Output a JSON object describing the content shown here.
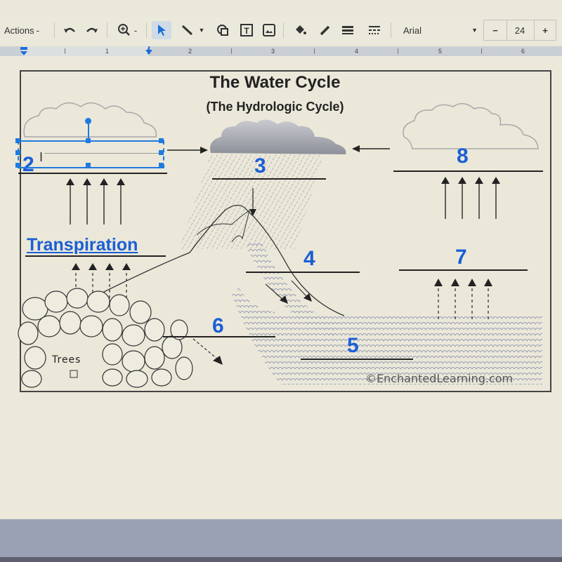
{
  "toolbar": {
    "actions_label": "Actions",
    "font_name": "Arial",
    "font_size": "24",
    "minus_label": "−",
    "plus_label": "+",
    "icons": [
      "undo-icon",
      "redo-icon",
      "zoom-icon",
      "select-pointer-icon",
      "line-icon",
      "shape-icon",
      "textbox-icon",
      "image-icon",
      "fill-color-icon",
      "line-color-icon",
      "line-weight-icon",
      "line-dash-icon"
    ]
  },
  "ruler": {
    "numbers": [
      "1",
      "2",
      "3",
      "4",
      "5",
      "6"
    ]
  },
  "diagram": {
    "title": "The Water Cycle",
    "subtitle": "(The Hydrologic Cycle)",
    "labels": {
      "n2": "2",
      "n3": "3",
      "n4": "4",
      "n5": "5",
      "n6": "6",
      "n7": "7",
      "n8": "8"
    },
    "transpiration": "Transpiration",
    "trees": "Trees",
    "copyright": "©EnchantedLearning.com"
  },
  "colors": {
    "label_blue": "#1a5fd6",
    "selection_blue": "#1f7ae0"
  }
}
